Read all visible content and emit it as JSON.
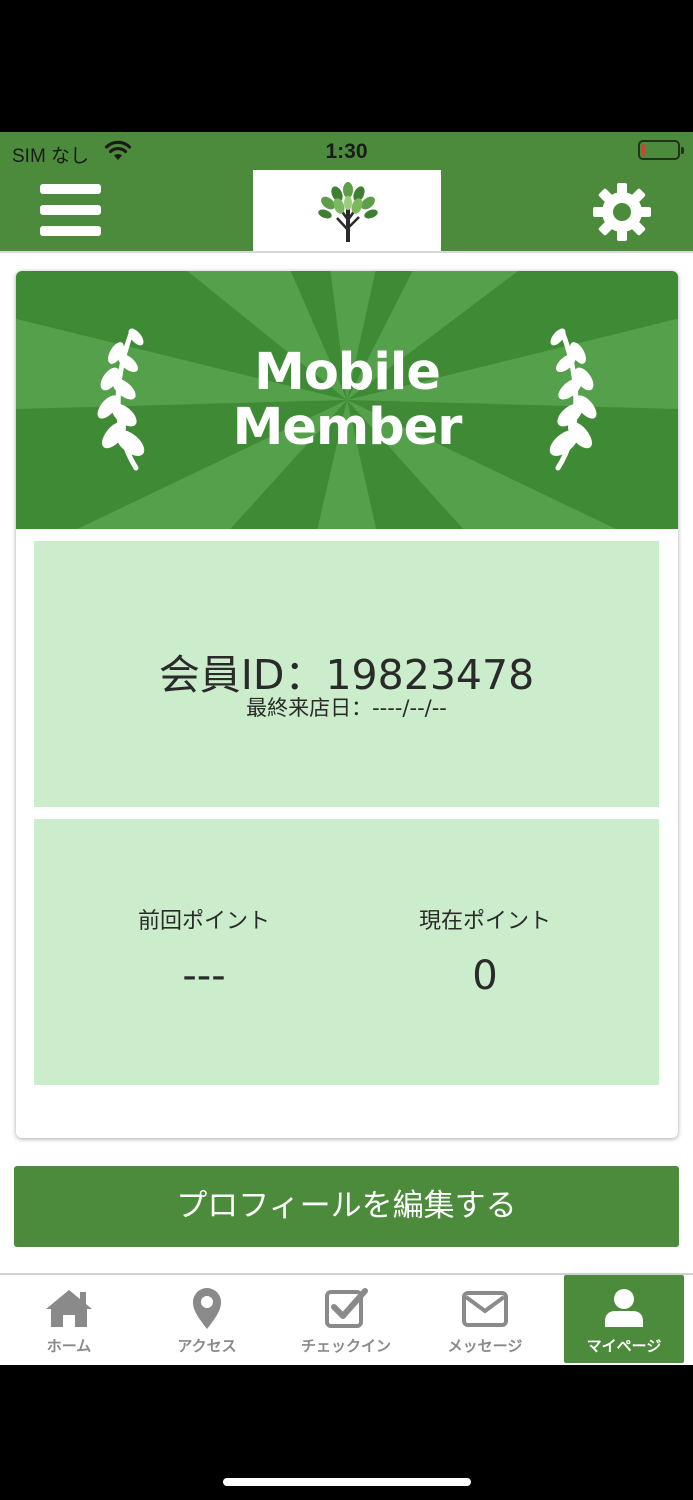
{
  "status_bar": {
    "carrier": "SIM なし",
    "time": "1:30",
    "battery_level": 0.1,
    "battery_color": "#e03b2f"
  },
  "header": {
    "menu_icon": "hamburger-menu-icon",
    "logo_icon": "tree-logo",
    "settings_icon": "gear-icon",
    "background": "#4b8b3b"
  },
  "membership_card": {
    "banner_title_line1": "Mobile",
    "banner_title_line2": "Member",
    "member_id_text": "会員ID：19823478",
    "last_visit_text": "最終来店日：----/--/--",
    "points": {
      "previous_label": "前回ポイント",
      "previous_value": "---",
      "current_label": "現在ポイント",
      "current_value": "0"
    },
    "panel_color": "#ccedcb"
  },
  "edit_profile_button": "プロフィールを編集する",
  "tab_bar": {
    "items": [
      {
        "label": "ホーム",
        "icon": "home-icon",
        "active": false
      },
      {
        "label": "アクセス",
        "icon": "map-pin-icon",
        "active": false
      },
      {
        "label": "チェックイン",
        "icon": "checkbox-icon",
        "active": false
      },
      {
        "label": "メッセージ",
        "icon": "envelope-icon",
        "active": false
      },
      {
        "label": "マイページ",
        "icon": "user-icon",
        "active": true
      }
    ]
  }
}
